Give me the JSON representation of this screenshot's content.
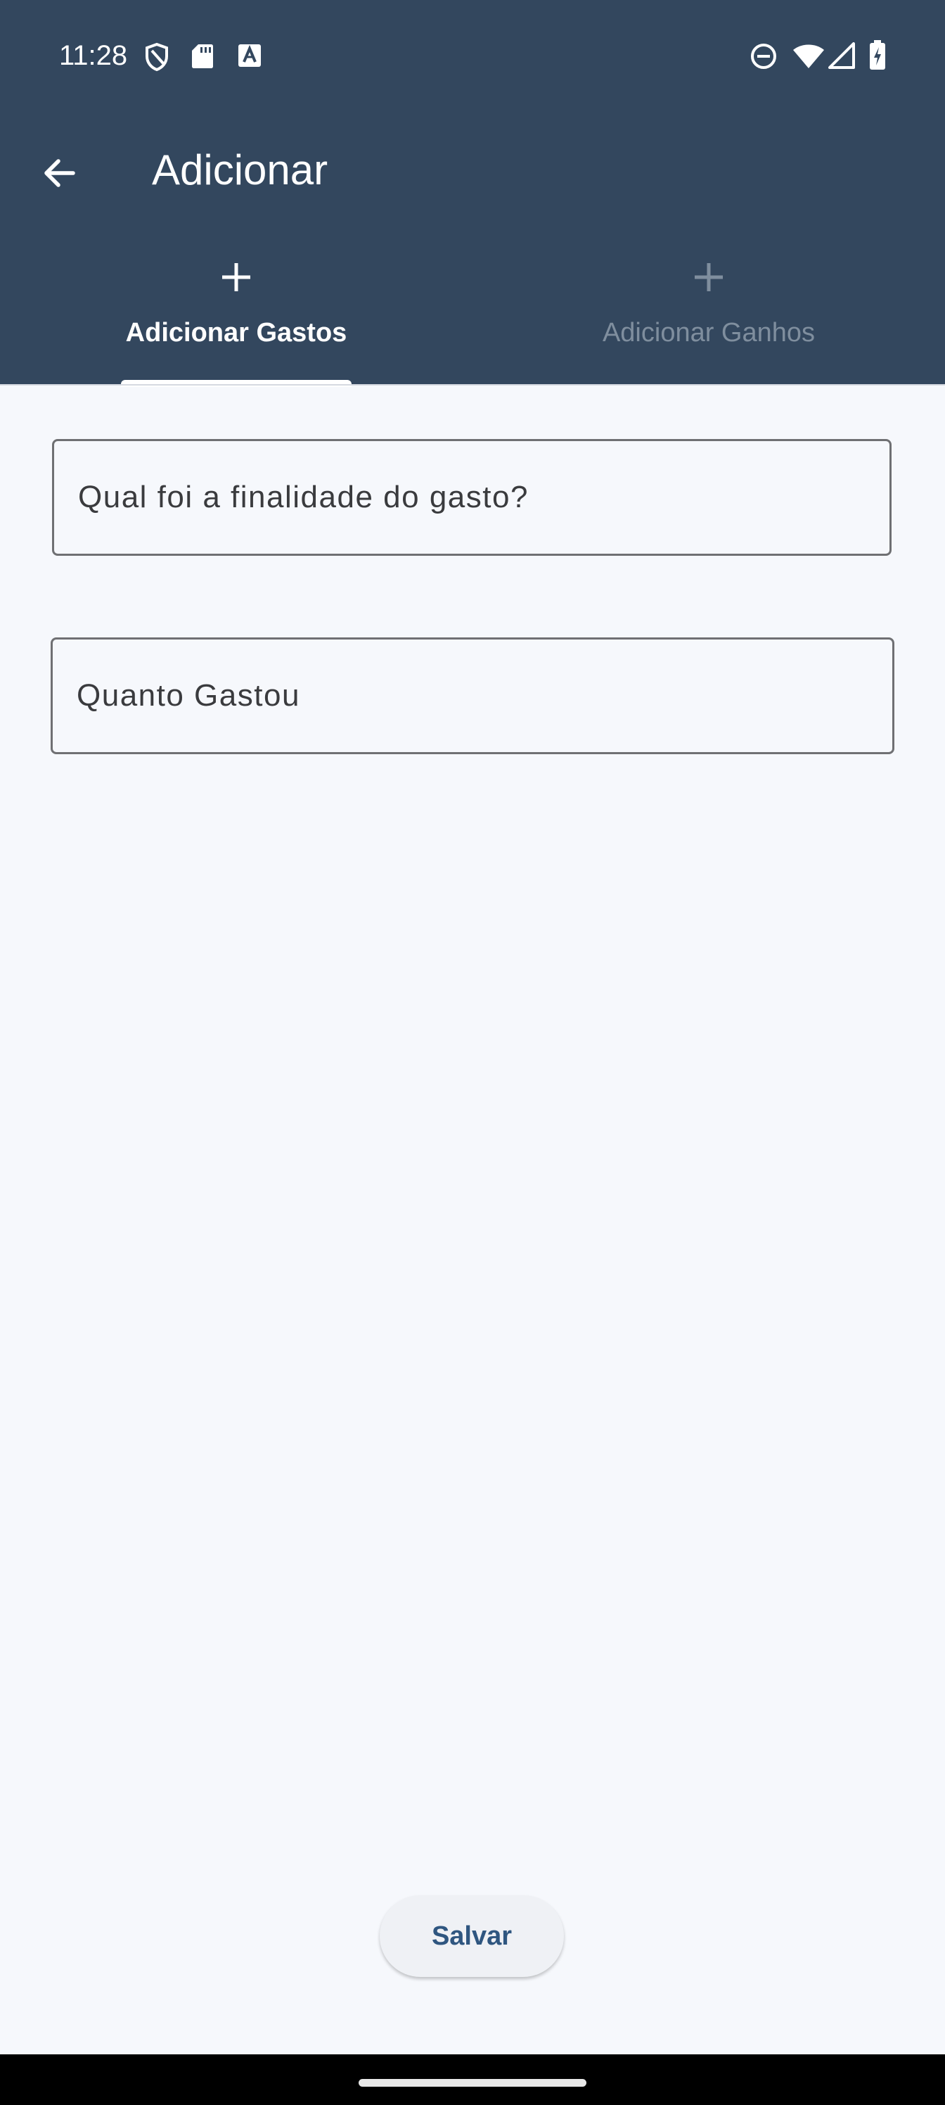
{
  "status_bar": {
    "time": "11:28",
    "left_icons": [
      "shield-icon",
      "sd-card-icon",
      "font-a-icon"
    ],
    "right_icons": [
      "do-not-disturb-icon",
      "wifi-icon",
      "cell-signal-icon",
      "battery-charging-icon"
    ]
  },
  "app_bar": {
    "back_icon": "arrow-left-icon",
    "title": "Adicionar"
  },
  "tabs": [
    {
      "label": "Adicionar Gastos",
      "icon": "plus-icon",
      "active": true
    },
    {
      "label": "Adicionar Ganhos",
      "icon": "plus-icon",
      "active": false
    }
  ],
  "form": {
    "purpose_placeholder": "Qual foi a finalidade do gasto?",
    "purpose_value": "",
    "amount_placeholder": "Quanto Gastou",
    "amount_value": ""
  },
  "actions": {
    "save_label": "Salvar"
  },
  "colors": {
    "app_bar_background": "#33475e",
    "page_background": "#f6f8fc",
    "active_tab_text": "#ffffff",
    "inactive_tab_text": "#7f8e9e",
    "button_text": "#2f5680"
  }
}
